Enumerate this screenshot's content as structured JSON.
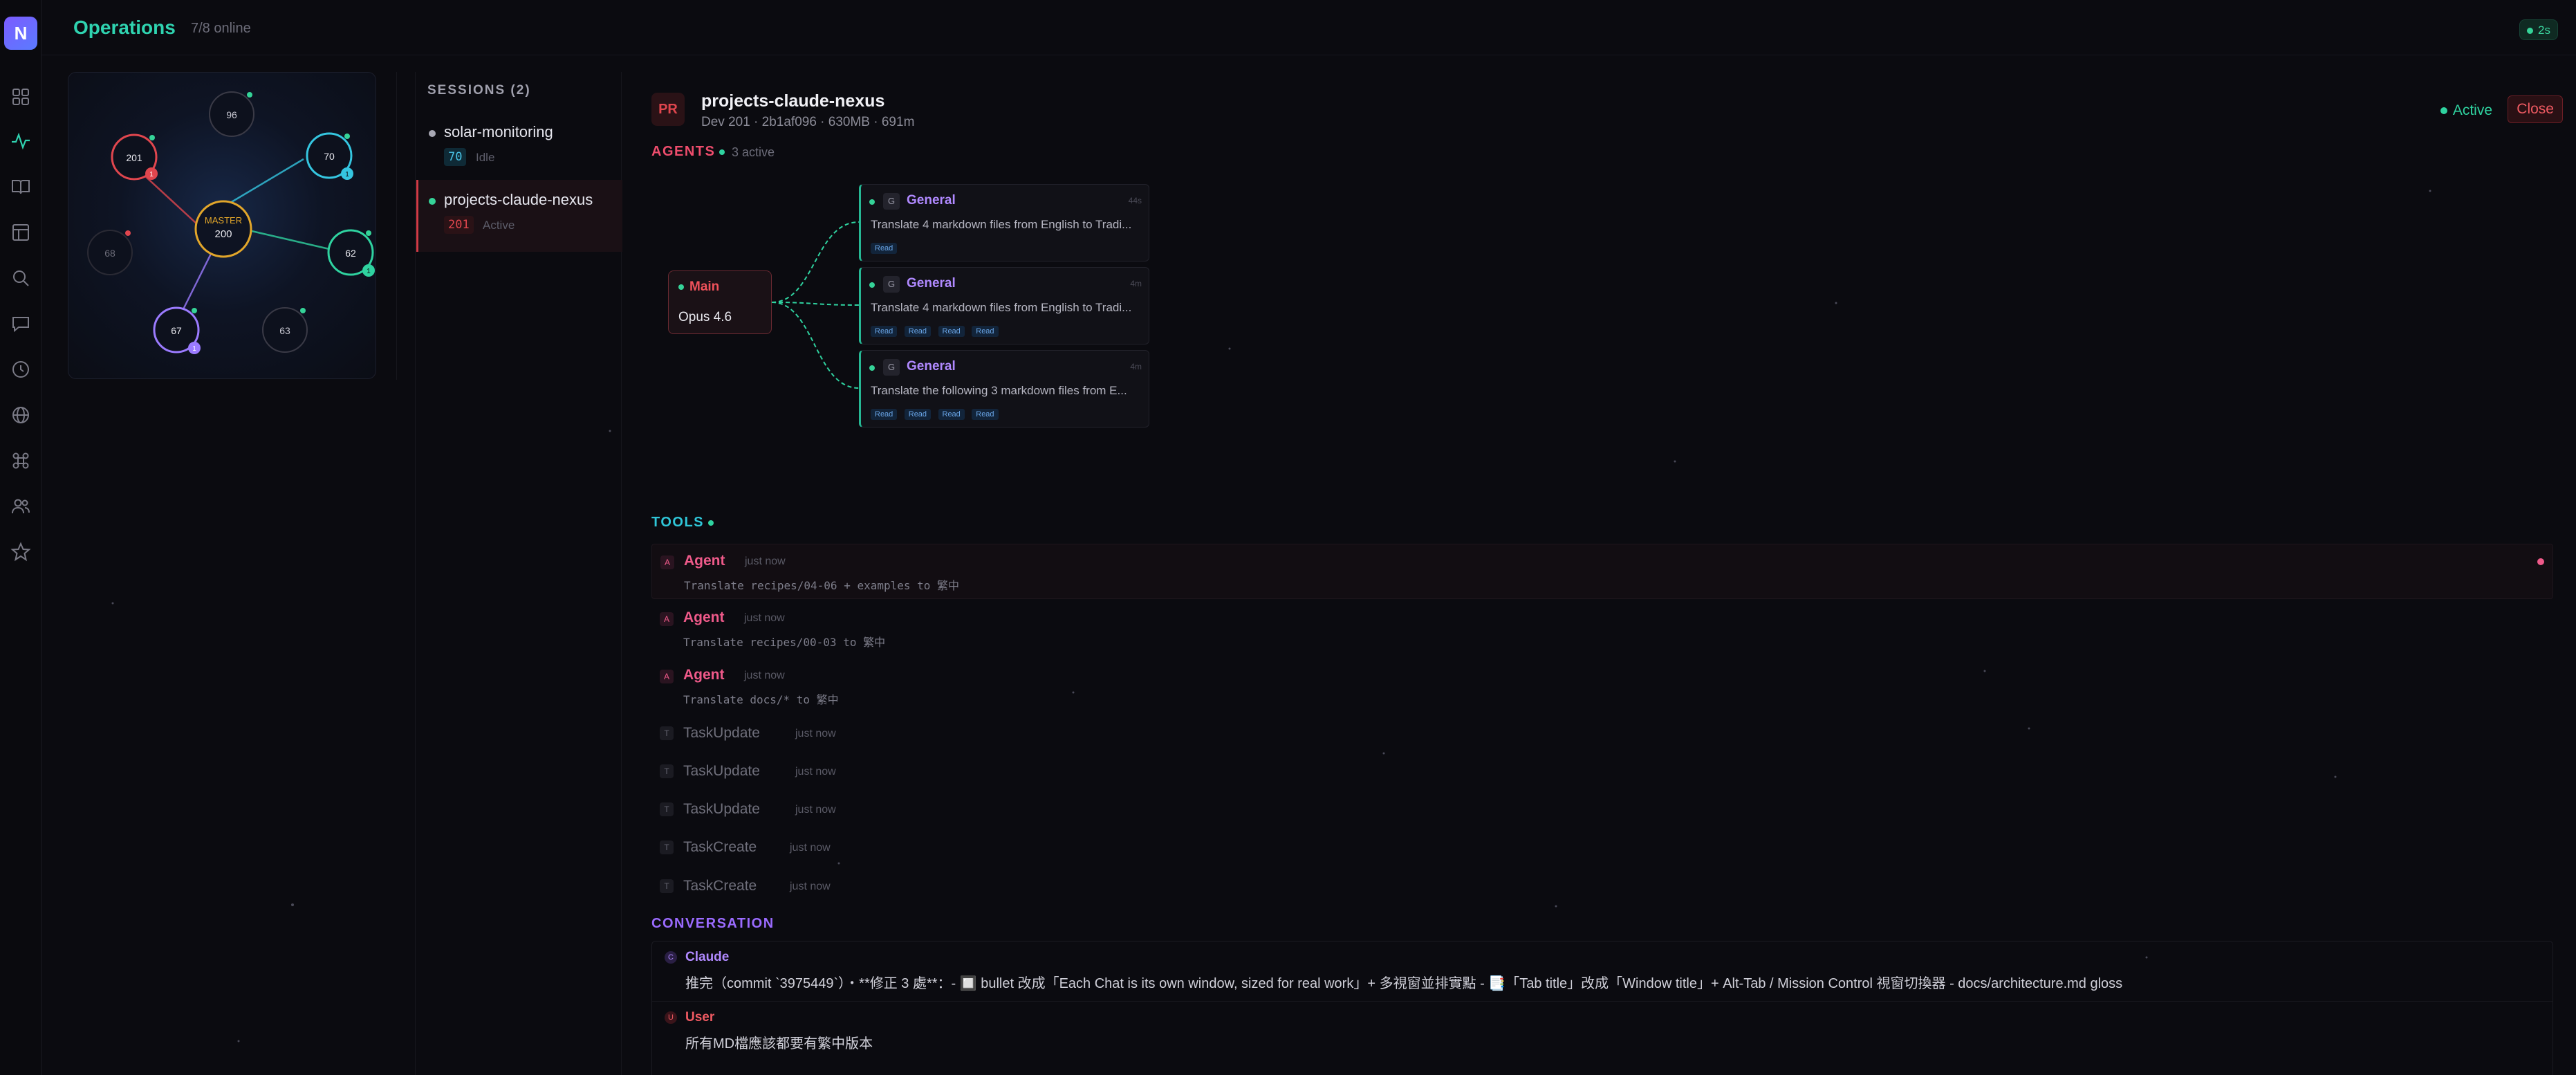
{
  "app": {
    "logo_letter": "N",
    "title": "Operations",
    "online": "7/8 online",
    "refresh_badge": "2s"
  },
  "rail": {
    "icons": [
      "grid-icon",
      "activity-icon",
      "book-icon",
      "layout-icon",
      "search-icon",
      "chat-icon",
      "clock-icon",
      "globe-icon",
      "command-icon",
      "users-icon",
      "star-icon"
    ],
    "active": "activity-icon"
  },
  "mini_graph": {
    "master_label": "MASTER",
    "master_value": "200",
    "nodes": [
      {
        "label": "96",
        "color": "#6a6a78",
        "badge": ""
      },
      {
        "label": "201",
        "color": "#e0464e",
        "badge": "1"
      },
      {
        "label": "70",
        "color": "#35c6e0",
        "badge": "1"
      },
      {
        "label": "68",
        "color": "#5a5a66",
        "badge": ""
      },
      {
        "label": "62",
        "color": "#2fd3a0",
        "badge": "1"
      },
      {
        "label": "67",
        "color": "#9b7bff",
        "badge": "1"
      },
      {
        "label": "63",
        "color": "#6a6a78",
        "badge": ""
      }
    ]
  },
  "sessions": {
    "title": "SESSIONS (2)",
    "items": [
      {
        "name": "solar-monitoring",
        "num": "70",
        "state": "Idle",
        "dot": "#a8a8b4",
        "num_bg": "#0f2a36",
        "num_fg": "#49c3e6"
      },
      {
        "name": "projects-claude-nexus",
        "num": "201",
        "state": "Active",
        "dot": "#35d398",
        "num_bg": "#2a1216",
        "num_fg": "#e0464e"
      }
    ]
  },
  "project": {
    "badge": "PR",
    "name": "projects-claude-nexus",
    "meta": "Dev 201 · 2b1af096 · 630MB · 691m",
    "status": "Active",
    "close_label": "Close"
  },
  "agents": {
    "label": "AGENTS",
    "count": "3 active",
    "main": {
      "label": "Main",
      "model": "Opus 4.6"
    },
    "cards": [
      {
        "icon": "G",
        "name": "General",
        "time": "44s",
        "text": "Translate 4 markdown files from English to Tradi...",
        "pills": [
          "Read"
        ]
      },
      {
        "icon": "G",
        "name": "General",
        "time": "4m",
        "text": "Translate 4 markdown files from English to Tradi...",
        "pills": [
          "Read",
          "Read",
          "Read",
          "Read"
        ]
      },
      {
        "icon": "G",
        "name": "General",
        "time": "4m",
        "text": "Translate the following 3 markdown files from E...",
        "pills": [
          "Read",
          "Read",
          "Read",
          "Read"
        ]
      }
    ]
  },
  "tools": {
    "label": "TOOLS",
    "rows": [
      {
        "icon": "A",
        "name": "Agent",
        "time": "just now",
        "desc": "Translate recipes/04-06 + examples to 繁中"
      },
      {
        "icon": "A",
        "name": "Agent",
        "time": "just now",
        "desc": "Translate recipes/00-03 to 繁中"
      },
      {
        "icon": "A",
        "name": "Agent",
        "time": "just now",
        "desc": "Translate docs/* to 繁中"
      },
      {
        "icon": "T",
        "name": "TaskUpdate",
        "time": "just now",
        "desc": ""
      },
      {
        "icon": "T",
        "name": "TaskUpdate",
        "time": "just now",
        "desc": ""
      },
      {
        "icon": "T",
        "name": "TaskUpdate",
        "time": "just now",
        "desc": ""
      },
      {
        "icon": "T",
        "name": "TaskCreate",
        "time": "just now",
        "desc": ""
      },
      {
        "icon": "T",
        "name": "TaskCreate",
        "time": "just now",
        "desc": ""
      }
    ]
  },
  "conversation": {
    "label": "CONVERSATION",
    "messages": [
      {
        "icon": "C",
        "who": "Claude",
        "text": "推完（commit `3975449`）・**修正 3 處**：- 🔲 bullet 改成「Each Chat is its own window, sized for real work」+ 多視窗並排實點 - 📑「Tab title」改成「Window title」+ Alt-Tab / Mission Control 視窗切換器 - docs/architecture.md gloss"
      },
      {
        "icon": "U",
        "who": "User",
        "text": "所有MD檔應該都要有繁中版本"
      }
    ]
  },
  "colors": {
    "accent": "#2fd3b0",
    "agents_label": "#ef4d6d",
    "tools_label": "#2fc6d8",
    "conversation_label": "#9b6bff",
    "agent_name": "#ef5a8a",
    "claude": "#b089ff",
    "user": "#ef5a62"
  }
}
